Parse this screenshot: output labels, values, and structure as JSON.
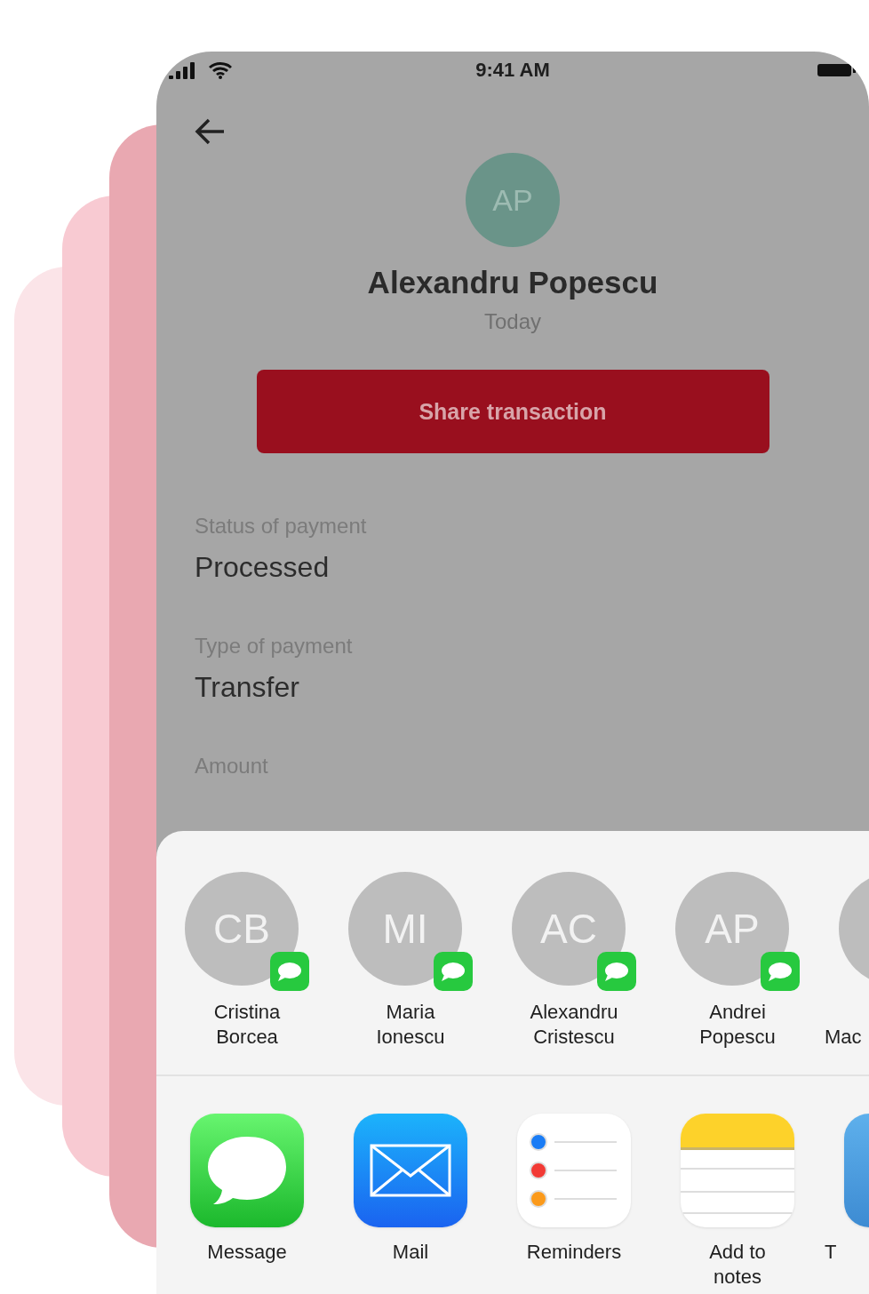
{
  "status_bar": {
    "time": "9:41 AM"
  },
  "profile": {
    "initials": "AP",
    "name": "Alexandru Popescu",
    "date": "Today"
  },
  "share_button": {
    "label": "Share transaction"
  },
  "details": [
    {
      "label": "Status of payment",
      "value": "Processed"
    },
    {
      "label": "Type of payment",
      "value": "Transfer"
    },
    {
      "label": "Amount"
    }
  ],
  "share_sheet": {
    "contacts": [
      {
        "initials": "CB",
        "name": "Cristina Borcea"
      },
      {
        "initials": "MI",
        "name": "Maria Ionescu"
      },
      {
        "initials": "AC",
        "name": "Alexandru Cristescu"
      },
      {
        "initials": "AP",
        "name": "Andrei Popescu"
      },
      {
        "name": "Mac"
      }
    ],
    "apps": [
      {
        "kind": "message",
        "label": "Message"
      },
      {
        "kind": "mail",
        "label": "Mail"
      },
      {
        "kind": "reminders",
        "label": "Reminders"
      },
      {
        "kind": "notes",
        "label": "Add to notes"
      },
      {
        "kind": "bird",
        "label": "T"
      }
    ]
  }
}
